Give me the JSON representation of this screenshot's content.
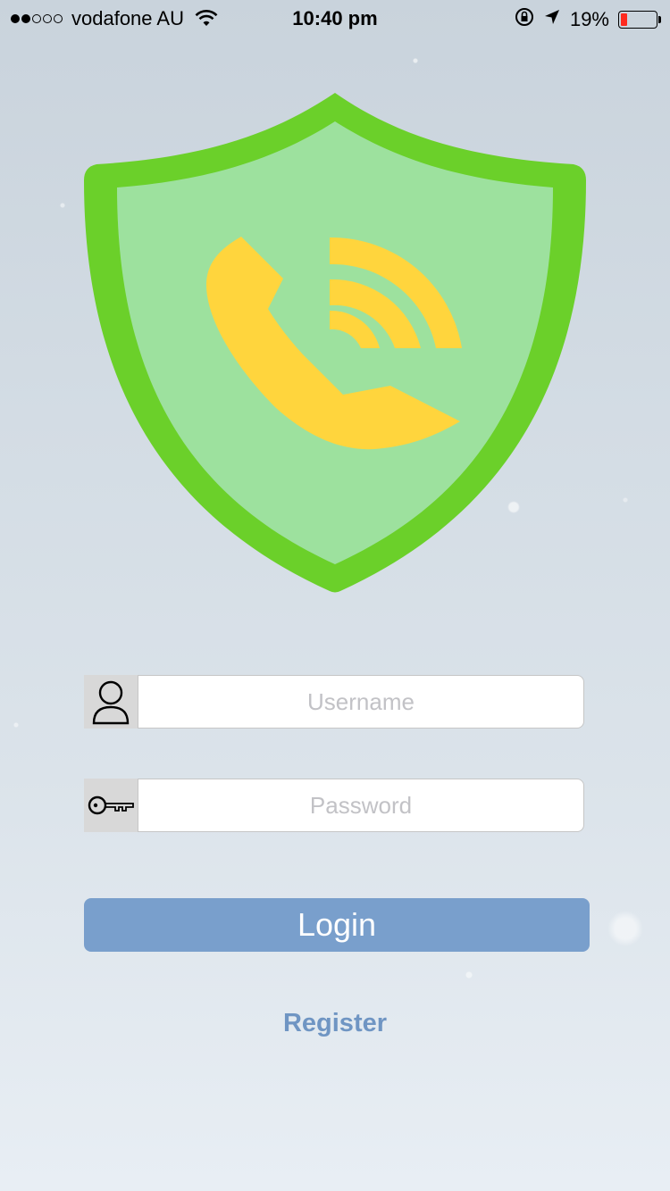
{
  "status_bar": {
    "signal_filled": 2,
    "signal_total": 5,
    "carrier": "vodafone AU",
    "time": "10:40 pm",
    "battery_percent": "19%",
    "battery_level": 0.19,
    "battery_color": "#ff2a1f"
  },
  "logo": {
    "shield_outer_color": "#6bd02a",
    "shield_inner_color": "#9de19e",
    "phone_color": "#ffd53d",
    "icon": "shield-phone-icon"
  },
  "login_form": {
    "username_placeholder": "Username",
    "username_value": "",
    "password_placeholder": "Password",
    "password_value": "",
    "login_label": "Login",
    "register_label": "Register",
    "button_color": "#799fcc"
  }
}
